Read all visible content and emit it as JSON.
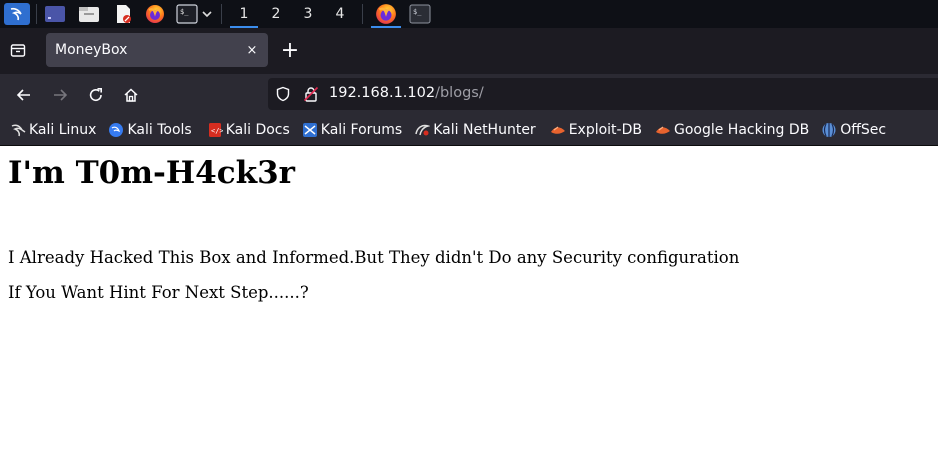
{
  "taskbar": {
    "workspaces": [
      "1",
      "2",
      "3",
      "4"
    ],
    "active_workspace": "1"
  },
  "browser": {
    "tab": {
      "title": "MoneyBox",
      "close": "×"
    },
    "new_tab": "+",
    "url": {
      "host": "192.168.1.102",
      "path": "/blogs/"
    },
    "bookmarks": [
      {
        "label": "Kali Linux",
        "icon": "kali-dragon-icon",
        "color": "#e0e0e0"
      },
      {
        "label": "Kali Tools",
        "icon": "kali-tools-icon",
        "color": "#367bf0"
      },
      {
        "label": "Kali Docs",
        "icon": "kali-docs-icon",
        "color": "#d62d20"
      },
      {
        "label": "Kali Forums",
        "icon": "kali-forums-icon",
        "color": "#4a90e2"
      },
      {
        "label": "Kali NetHunter",
        "icon": "nethunter-icon",
        "color": "#d62d20"
      },
      {
        "label": "Exploit-DB",
        "icon": "exploit-db-icon",
        "color": "#e8632e"
      },
      {
        "label": "Google Hacking DB",
        "icon": "ghdb-icon",
        "color": "#e8632e"
      },
      {
        "label": "OffSec",
        "icon": "offsec-icon",
        "color": "#5a8fd6"
      }
    ]
  },
  "page": {
    "heading": "I'm T0m-H4ck3r",
    "paragraph1": "I Already Hacked This Box and Informed.But They didn't Do any Security configuration",
    "paragraph2": "If You Want Hint For Next Step......?"
  }
}
